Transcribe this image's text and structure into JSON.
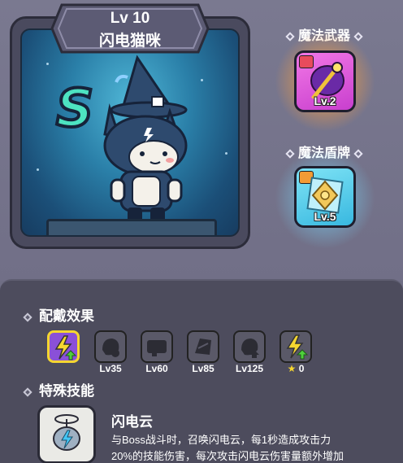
{
  "character": {
    "level": "Lv 10",
    "name": "闪电猫咪",
    "rank": "S"
  },
  "equipment": {
    "weapon": {
      "title": "魔法武器",
      "level": "Lv.2",
      "icon": "magic-staff-icon",
      "color": "#d24fd6"
    },
    "shield": {
      "title": "魔法盾牌",
      "level": "Lv.5",
      "icon": "magic-shield-icon",
      "color": "#45c7e8"
    }
  },
  "wear_effects": {
    "title": "配戴效果",
    "items": [
      {
        "label": "",
        "icon": "lightning-up-icon",
        "active": true
      },
      {
        "label": "Lv35",
        "icon": "locked-effect-icon",
        "active": false
      },
      {
        "label": "Lv60",
        "icon": "locked-effect-icon",
        "active": false
      },
      {
        "label": "Lv85",
        "icon": "locked-effect-icon",
        "active": false
      },
      {
        "label": "Lv125",
        "icon": "locked-effect-icon",
        "active": false
      },
      {
        "label": "0",
        "icon": "lightning-up-icon",
        "active": false,
        "star": true
      }
    ]
  },
  "special_skill": {
    "title": "特殊技能",
    "name": "闪电云",
    "desc_line1": "与Boss战斗时，召唤闪电云，每1秒造成攻击力",
    "desc_line2": "20%的技能伤害，每次攻击闪电云伤害量额外增加"
  },
  "colors": {
    "background": "#6f6e84",
    "panel": "#4d4c5d",
    "rank": "#4de3c1",
    "lightning": "#f5d630"
  }
}
